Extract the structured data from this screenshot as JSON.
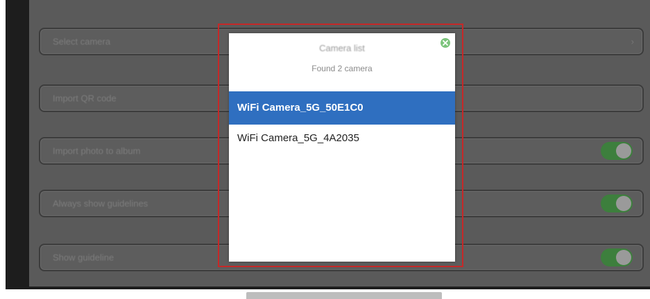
{
  "settings": {
    "rows": [
      {
        "label": "Select camera",
        "control": "chevron"
      },
      {
        "label": "Import QR code",
        "control": "none"
      },
      {
        "label": "Import photo to album",
        "control": "toggle",
        "on": true
      },
      {
        "label": "Always show guidelines",
        "control": "toggle",
        "on": true
      },
      {
        "label": "Show guideline",
        "control": "toggle",
        "on": true
      }
    ]
  },
  "dialog": {
    "title": "Camera list",
    "subtitle": "Found 2 camera",
    "cameras": [
      {
        "name": "WiFi Camera_5G_50E1C0",
        "selected": true
      },
      {
        "name": "WiFi Camera_5G_4A2035",
        "selected": false
      }
    ]
  },
  "colors": {
    "selection": "#2f6fc0",
    "highlight_border": "#c62828",
    "toggle_on": "#3d7f3d",
    "close_icon": "#7cc47c"
  },
  "icons": {
    "close": "close-icon",
    "chevron": "chevron-right-icon"
  }
}
